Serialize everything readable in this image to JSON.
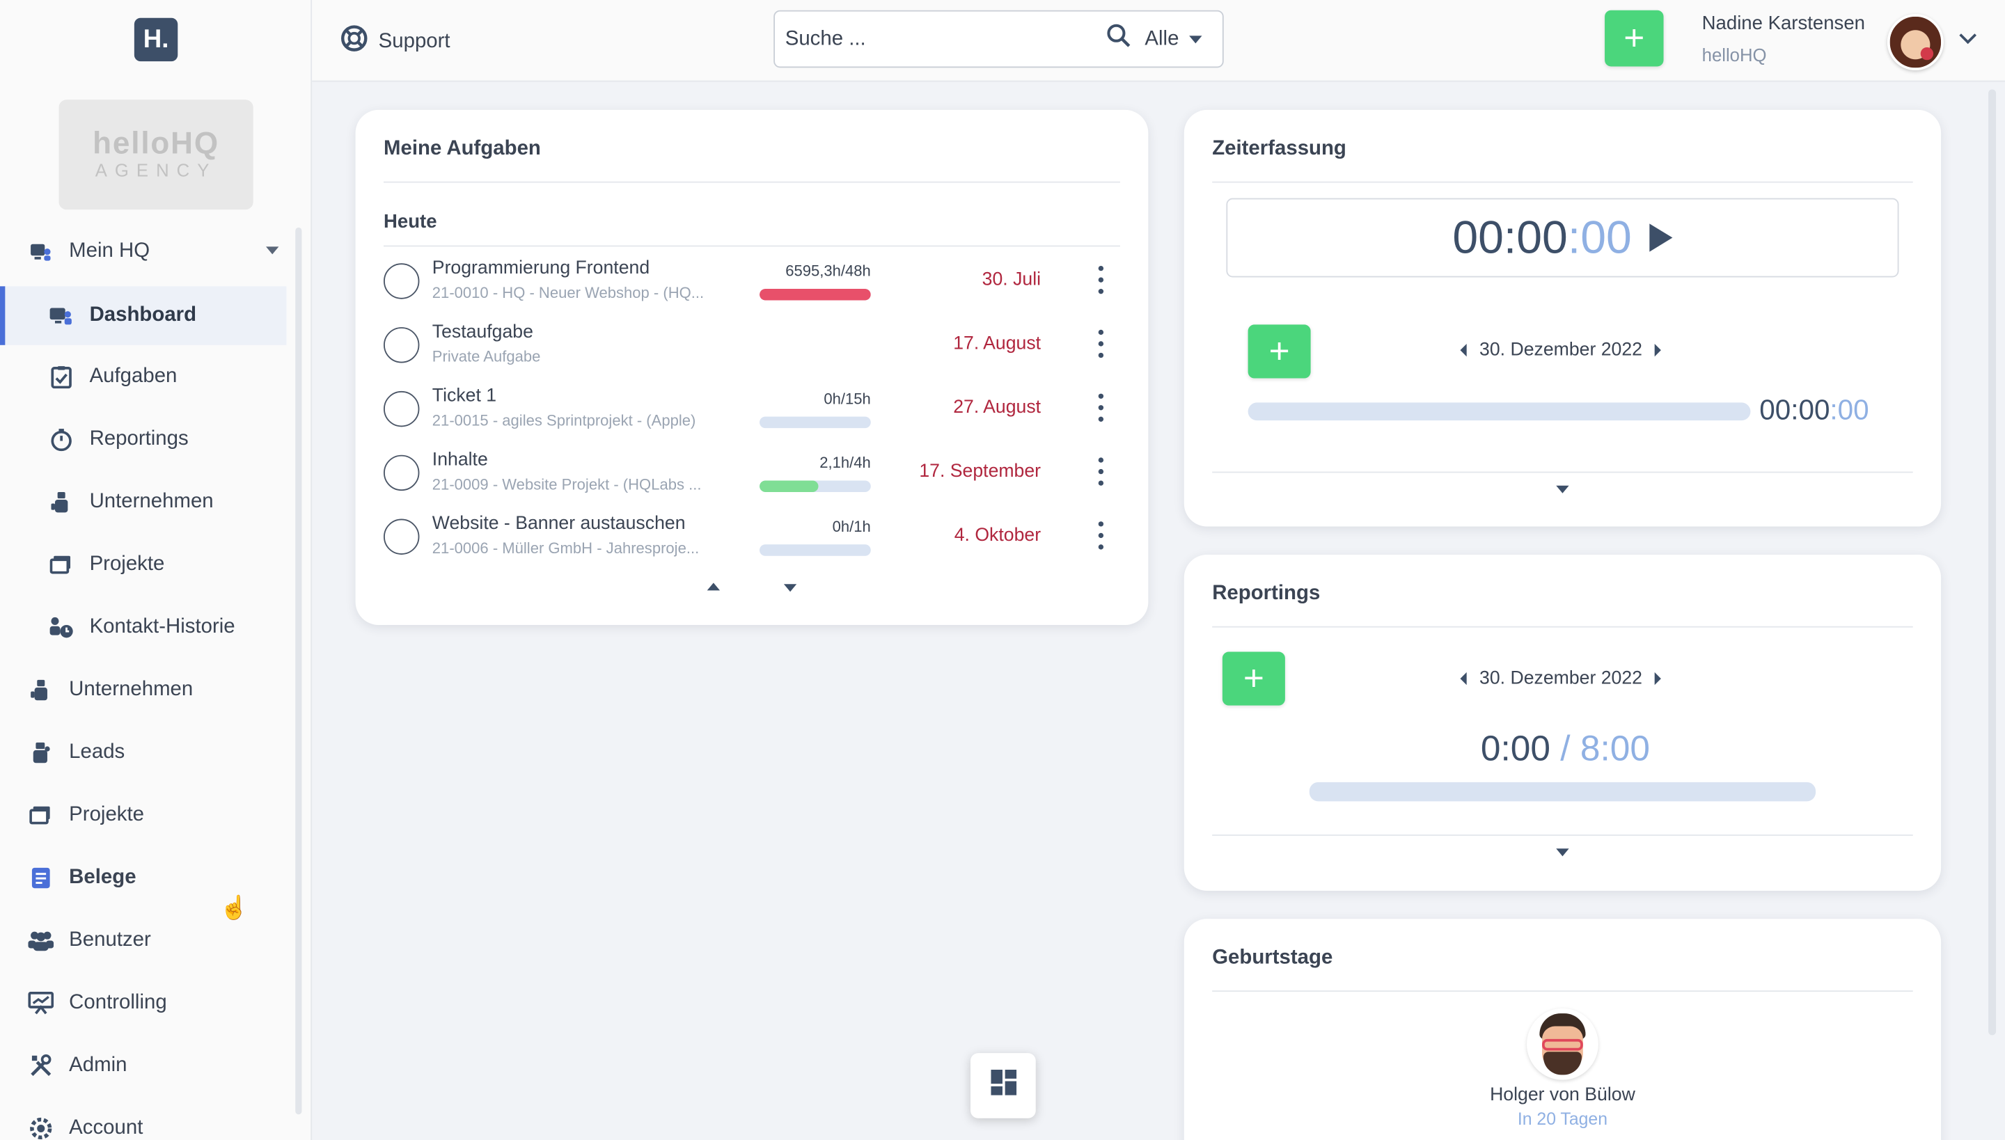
{
  "brand": {
    "logo_letter": "H.",
    "agency_line1": "helloHQ",
    "agency_line2": "AGENCY"
  },
  "topbar": {
    "support_label": "Support",
    "search_placeholder": "Suche ...",
    "search_scope": "Alle",
    "user_name": "Nadine Karstensen",
    "user_org": "helloHQ"
  },
  "sidebar": {
    "items": [
      {
        "label": "Mein HQ",
        "icon": "home-user-icon"
      },
      {
        "label": "Dashboard",
        "icon": "dashboard-icon"
      },
      {
        "label": "Aufgaben",
        "icon": "tasks-icon"
      },
      {
        "label": "Reportings",
        "icon": "stopwatch-icon"
      },
      {
        "label": "Unternehmen",
        "icon": "company-icon"
      },
      {
        "label": "Projekte",
        "icon": "projects-icon"
      },
      {
        "label": "Kontakt-Historie",
        "icon": "contacts-history-icon"
      },
      {
        "label": "Unternehmen",
        "icon": "company-icon"
      },
      {
        "label": "Leads",
        "icon": "leads-icon"
      },
      {
        "label": "Projekte",
        "icon": "projects-icon"
      },
      {
        "label": "Belege",
        "icon": "receipt-icon"
      },
      {
        "label": "Benutzer",
        "icon": "users-icon"
      },
      {
        "label": "Controlling",
        "icon": "controlling-icon"
      },
      {
        "label": "Admin",
        "icon": "tools-icon"
      },
      {
        "label": "Account",
        "icon": "gear-icon"
      }
    ]
  },
  "tasks_card": {
    "title": "Meine Aufgaben",
    "section": "Heute",
    "tasks": [
      {
        "name": "Programmierung Frontend",
        "sub": "21-0010 - HQ - Neuer Webshop - (HQ...",
        "hours": "6595,3h/48h",
        "progress": 1.0,
        "bar_color": "#e8506a",
        "due": "30. Juli"
      },
      {
        "name": "Testaufgabe",
        "sub": "Private Aufgabe",
        "hours": "",
        "progress": 0,
        "bar_color": "",
        "due": "17. August"
      },
      {
        "name": "Ticket 1",
        "sub": "21-0015 - agiles Sprintprojekt - (Apple)",
        "hours": "0h/15h",
        "progress": 0,
        "bar_color": "#4bd67c",
        "due": "27. August"
      },
      {
        "name": "Inhalte",
        "sub": "21-0009 - Website Projekt - (HQLabs ...",
        "hours": "2,1h/4h",
        "progress": 0.525,
        "bar_color": "#7fde95",
        "due": "17. September"
      },
      {
        "name": "Website - Banner austauschen",
        "sub": "21-0006 - Müller GmbH - Jahresproje...",
        "hours": "0h/1h",
        "progress": 0,
        "bar_color": "#4bd67c",
        "due": "4. Oktober"
      }
    ]
  },
  "time_card": {
    "title": "Zeiterfassung",
    "timer_main": "00:00",
    "timer_secs": ":00",
    "date": "30. Dezember 2022",
    "day_main": "00:00",
    "day_secs": ":00"
  },
  "reportings_card": {
    "title": "Reportings",
    "date": "30. Dezember 2022",
    "logged": "0:00",
    "target": " / 8:00",
    "progress": 0
  },
  "birthdays_card": {
    "title": "Geburtstage",
    "name": "Holger von Bülow",
    "when": "In 20 Tagen"
  },
  "colors": {
    "accent": "#4a6fd8",
    "add": "#4bd67c",
    "due": "#b0263e",
    "muted_blue": "#8fb0e3"
  }
}
